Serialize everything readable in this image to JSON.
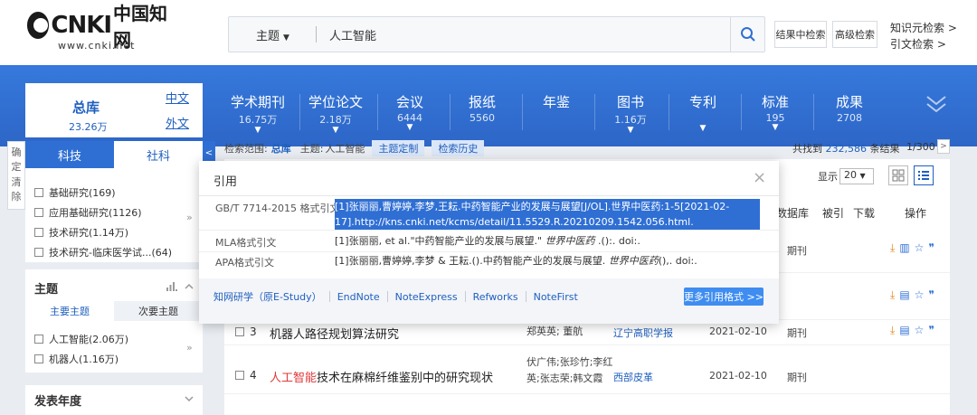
{
  "header": {
    "logo_text": "CNKI",
    "logo_cn": "中国知网",
    "logo_url": "www.cnki.net",
    "search_type": "主题",
    "search_value": "人工智能",
    "btn_within": "结果中检索",
    "btn_advanced": "高级检索",
    "link_knowledge": "知识元检索 >",
    "link_citation": "引文检索 >"
  },
  "database": {
    "total_label": "总库",
    "total_count": "23.26万",
    "lang_cn": "中文",
    "lang_en": "外文",
    "categories": [
      {
        "name": "学术期刊",
        "count": "16.75万",
        "caret": "▼"
      },
      {
        "name": "学位论文",
        "count": "2.18万",
        "caret": "▼"
      },
      {
        "name": "会议",
        "count": "6444",
        "caret": "▼"
      },
      {
        "name": "报纸",
        "count": "5560",
        "caret": ""
      },
      {
        "name": "年鉴",
        "count": "",
        "caret": ""
      },
      {
        "name": "图书",
        "count": "1.16万",
        "caret": "▼"
      },
      {
        "name": "专利",
        "count": "",
        "caret": "▼"
      },
      {
        "name": "标准",
        "count": "195",
        "caret": "▼"
      },
      {
        "name": "成果",
        "count": "2708",
        "caret": ""
      }
    ]
  },
  "sidebar": {
    "side_buttons": [
      "确定",
      "清除"
    ],
    "tab_keji": "科技",
    "tab_sheke": "社科",
    "items": [
      {
        "label": "基础研究(169)"
      },
      {
        "label": "应用基础研究(1126)"
      },
      {
        "label": "技术研究(1.14万)"
      },
      {
        "label": "技术研究-临床医学试...(64)"
      }
    ],
    "topic_title": "主题",
    "subtab_main": "主要主题",
    "subtab_secondary": "次要主题",
    "topic_items": [
      {
        "label": "人工智能(2.06万)"
      },
      {
        "label": "机器人(1.16万)"
      }
    ],
    "year_title": "发表年度"
  },
  "results": {
    "scope_label": "检索范围:",
    "scope_value": "总库",
    "topic_label": "主题:",
    "topic_value": "人工智能",
    "chip_custom": "主题定制",
    "chip_history": "检索历史",
    "found_prefix": "共找到",
    "found_count": "232,586",
    "found_suffix": "条结果",
    "page": "1/300",
    "show_label": "显示",
    "show_value": "20",
    "columns": {
      "db": "数据库",
      "cited": "被引",
      "download": "下载",
      "ops": "操作"
    },
    "rows": [
      {
        "num": "",
        "title_hl": "",
        "title_rest": "",
        "authors": "",
        "source": "",
        "date": "",
        "db": "期刊"
      },
      {
        "num": "",
        "title_hl": "",
        "title_rest": "",
        "authors": "",
        "source": "",
        "date": "",
        "db": ""
      },
      {
        "num": "3",
        "title_hl": "",
        "title_rest": "机器人路径规划算法研究",
        "authors": "郑英英; 董航",
        "source": "辽宁高职学报",
        "date": "2021-02-10",
        "db": "期刊"
      },
      {
        "num": "4",
        "title_hl": "人工智能",
        "title_rest": "技术在麻棉纤维鉴别中的研究现状",
        "authors": "伏广伟;张珍竹;李红\n英;张志荣;韩文霞",
        "source": "西部皮革",
        "date": "2021-02-10",
        "db": "期刊"
      }
    ]
  },
  "citation_modal": {
    "title": "引用",
    "close": "×",
    "formats": [
      {
        "label": "GB/T 7714-2015 格式引文",
        "text": "[1]张丽丽,曹婷婷,李梦,王耘.中药智能产业的发展与展望[J/OL].世界中医药:1-5[2021-02-17].http://kns.cnki.net/kcms/detail/11.5529.R.20210209.1542.056.html."
      },
      {
        "label": "MLA格式引文",
        "text_pre": "[1]张丽丽, et al.\"中药智能产业的发展与展望.\" ",
        "text_italic": "世界中医药",
        "text_post": " .():. doi:."
      },
      {
        "label": "APA格式引文",
        "text_pre": "[1]张丽丽,曹婷婷,李梦 & 王耘.().中药智能产业的发展与展望. ",
        "text_italic": "世界中医药",
        "text_post": "(),. doi:."
      }
    ],
    "export_links": [
      "知网研学（原E-Study）",
      "EndNote",
      "NoteExpress",
      "Refworks",
      "NoteFirst"
    ],
    "more_formats": "更多引用格式 >>"
  },
  "colors": {
    "brand_blue": "#2f6fd4",
    "highlight_red": "#e03a3a",
    "selection_blue": "#2f6fd4",
    "download_orange": "#e08a1e"
  }
}
